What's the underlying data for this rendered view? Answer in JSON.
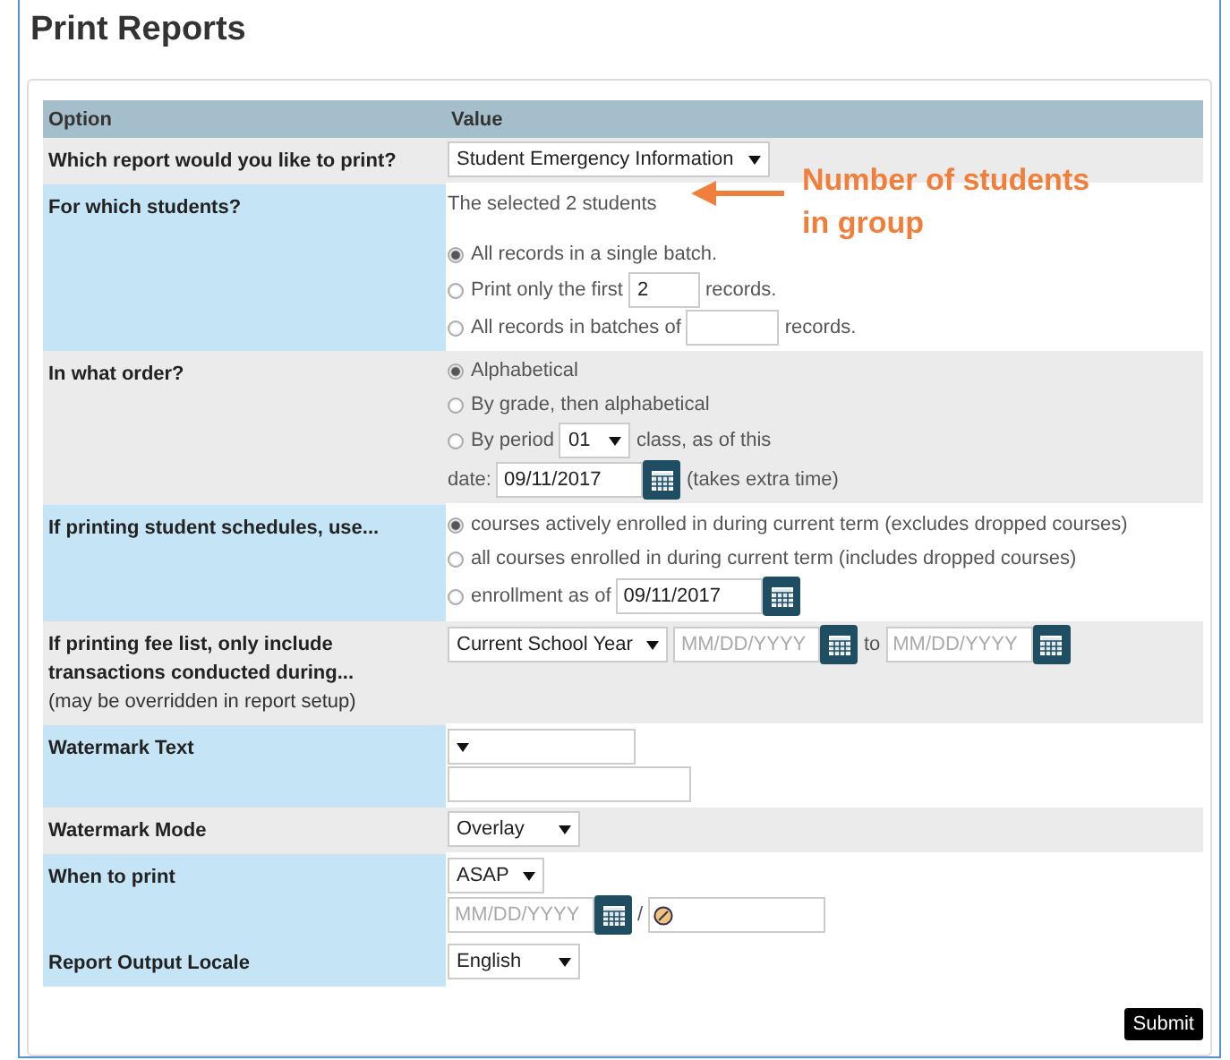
{
  "title": "Print Reports",
  "table": {
    "columns": [
      "Option",
      "Value"
    ],
    "rows": [
      {
        "label": "Which report would you like to print?",
        "highlighted": false,
        "lines": [
          {
            "items": [
              {
                "kind": "select",
                "value": "Student Emergency Information"
              }
            ]
          }
        ]
      },
      {
        "label": "For which students?",
        "highlighted": true,
        "lines": [
          {
            "items": [
              {
                "kind": "caption",
                "text": "The selected 2 students"
              }
            ]
          },
          {
            "items": [
              {
                "kind": "radio",
                "selected": true,
                "label": "All records in a single batch."
              }
            ]
          },
          {
            "items": [
              {
                "kind": "radio",
                "selected": false,
                "label": "Print only the first"
              },
              {
                "kind": "number-input",
                "value": "2"
              },
              {
                "kind": "text",
                "text": "records."
              }
            ]
          },
          {
            "items": [
              {
                "kind": "radio",
                "selected": false,
                "label": "All records in batches of"
              },
              {
                "kind": "number-input"
              },
              {
                "kind": "text",
                "text": "records."
              }
            ]
          }
        ]
      },
      {
        "label": "In what order?",
        "highlighted": false,
        "lines": [
          {
            "items": [
              {
                "kind": "radio",
                "selected": true,
                "label": "Alphabetical"
              }
            ]
          },
          {
            "items": [
              {
                "kind": "radio",
                "selected": false,
                "label": "By grade, then alphabetical"
              }
            ]
          },
          {
            "items": [
              {
                "kind": "radio",
                "selected": false,
                "label": "By period"
              },
              {
                "kind": "select",
                "value": "01"
              },
              {
                "kind": "text",
                "text": "class, as of this"
              }
            ]
          },
          {
            "items": [
              {
                "kind": "text",
                "text": "date:"
              },
              {
                "kind": "date",
                "value": "09/11/2017"
              },
              {
                "kind": "text",
                "text": "(takes extra time)"
              }
            ]
          }
        ]
      },
      {
        "label": "If printing student schedules, use...",
        "highlighted": true,
        "lines": [
          {
            "items": [
              {
                "kind": "radio",
                "selected": true,
                "label": "courses actively enrolled in during current term (excludes dropped courses)"
              }
            ]
          },
          {
            "items": [
              {
                "kind": "radio",
                "selected": false,
                "label": "all courses enrolled in during current term (includes dropped courses)"
              }
            ]
          },
          {
            "items": [
              {
                "kind": "radio",
                "selected": false,
                "label": "enrollment as of"
              },
              {
                "kind": "date",
                "value": "09/11/2017"
              }
            ]
          }
        ]
      },
      {
        "label": "If printing fee list, only include transactions conducted during...",
        "note": "(may be overridden in report setup)",
        "highlighted": false,
        "lines": [
          {
            "items": [
              {
                "kind": "select",
                "value": "Current School Year"
              },
              {
                "kind": "date",
                "placeholder": "MM/DD/YYYY"
              },
              {
                "kind": "text",
                "text": "to"
              },
              {
                "kind": "date",
                "placeholder": "MM/DD/YYYY"
              }
            ]
          }
        ]
      },
      {
        "label": "Watermark Text",
        "highlighted": true,
        "lines": [
          {
            "items": [
              {
                "kind": "select"
              }
            ]
          },
          {
            "items": [
              {
                "kind": "input"
              }
            ]
          }
        ]
      },
      {
        "label": "Watermark Mode",
        "highlighted": false,
        "lines": [
          {
            "items": [
              {
                "kind": "select",
                "value": "Overlay"
              }
            ]
          }
        ]
      },
      {
        "label": "When to print",
        "highlighted": true,
        "lines": [
          {
            "items": [
              {
                "kind": "select",
                "value": "ASAP"
              }
            ]
          },
          {
            "items": [
              {
                "kind": "date",
                "placeholder": "MM/DD/YYYY"
              },
              {
                "kind": "text",
                "text": "/"
              },
              {
                "kind": "time"
              }
            ]
          }
        ]
      },
      {
        "label": "Report Output Locale",
        "highlighted": true,
        "lines": [
          {
            "items": [
              {
                "kind": "select",
                "value": "English"
              }
            ]
          }
        ]
      }
    ]
  },
  "annotation": {
    "text": "Number of students in group"
  },
  "submit": "Submit"
}
